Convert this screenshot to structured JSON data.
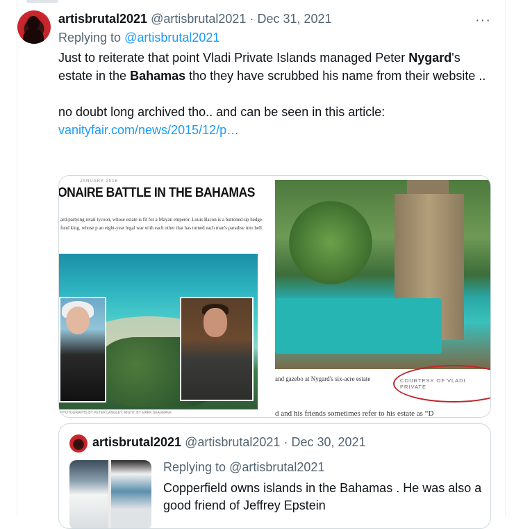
{
  "tweet": {
    "display_name": "artisbrutal2021",
    "handle": "@artisbrutal2021",
    "separator": "·",
    "date": "Dec 31, 2021",
    "more_label": "···",
    "replying_prefix": "Replying to",
    "replying_handle": "@artisbrutal2021",
    "text_p1_a": "Just to reiterate that point Vladi Private Islands managed Peter ",
    "text_p1_bold1": "Nygard",
    "text_p1_b": "'s estate in the ",
    "text_p1_bold2": "Bahamas",
    "text_p1_c": " tho they have scrubbed his name from their website ..",
    "text_p2": "no doubt long archived tho.. and can be seen in this article: ",
    "link_text": "vanityfair.com/news/2015/12/p…"
  },
  "media": {
    "mag_date": "JANUARY 2016",
    "mag_headline": "ONAIRE BATTLE IN THE BAHAMAS",
    "mag_subhead": "ard-partying retail tycoon, whose estate is fit for a Mayan emperor. Louis Bacon is a buttoned-up hedge-fund king, whose p  an eight-year legal war with each other that has turned each man's paradise into hell.",
    "photo_credit": "PHOTOGRAPHS BY PETER LANGLEY. RIGHT, BY MARK SEAGRAVE",
    "caption": "and gazebo at Nygard's six-acre estate",
    "courtesy": "COURTESY OF VLADI PRIVATE",
    "cut_text": "d and his friends sometimes refer to his estate as “D"
  },
  "quote": {
    "display_name": "artisbrutal2021",
    "handle": "@artisbrutal2021",
    "separator": "·",
    "date": "Dec 30, 2021",
    "replying_prefix": "Replying to",
    "replying_handle": "@artisbrutal2021",
    "text": "Copperfield owns islands in the Bahamas . He was also a good friend of Jeffrey Epstein"
  },
  "colors": {
    "link": "#1d9bf0",
    "secondary_text": "#536471",
    "primary_text": "#0f1419",
    "border": "#cfd9de",
    "annotation_circle": "#c0262b"
  }
}
